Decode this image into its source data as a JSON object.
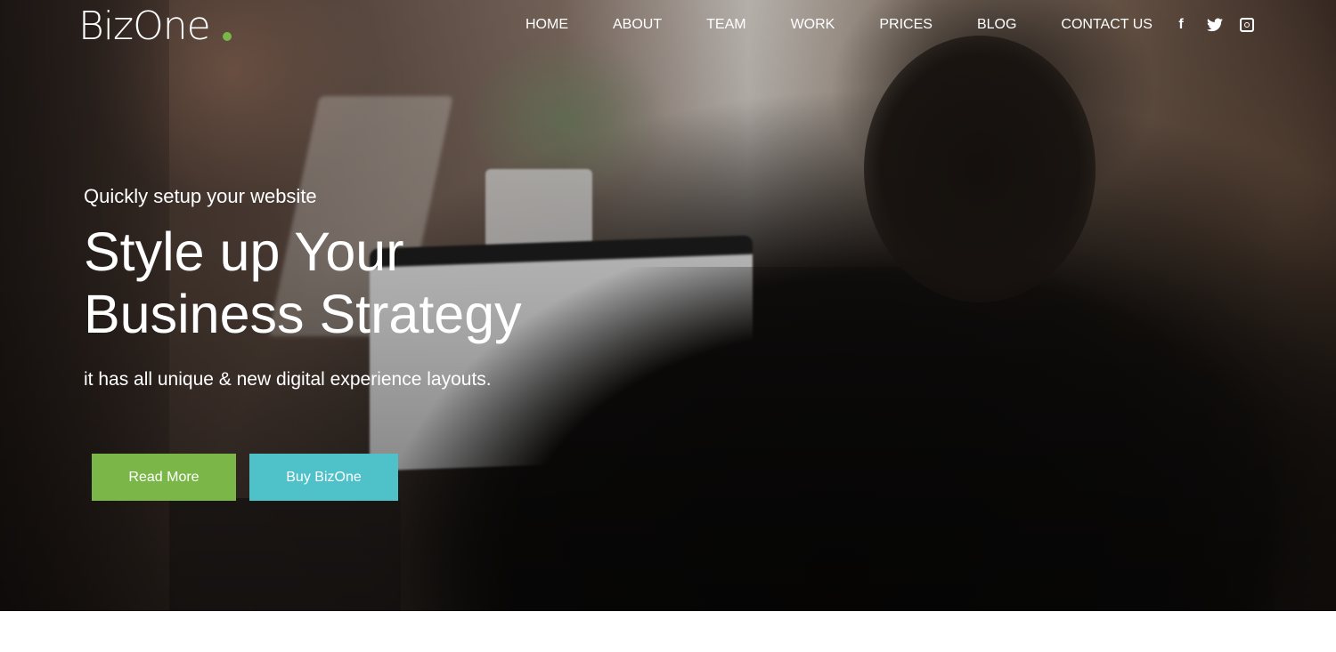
{
  "brand": {
    "name": "BizOne",
    "accent_color": "#7ab648"
  },
  "nav": {
    "items": [
      "HOME",
      "ABOUT",
      "TEAM",
      "WORK",
      "PRICES",
      "BLOG",
      "CONTACT US"
    ],
    "social_icons": [
      "facebook-icon",
      "twitter-icon",
      "instagram-icon"
    ]
  },
  "hero": {
    "tagline": "Quickly setup your website",
    "headline_line1": "Style up Your",
    "headline_line2": "Business Strategy",
    "subline": "it has all unique & new digital experience layouts.",
    "buttons": {
      "primary": {
        "label": "Read More",
        "color": "#7ab648"
      },
      "secondary": {
        "label": "Buy BizOne",
        "color": "#4fc1c9"
      }
    }
  }
}
